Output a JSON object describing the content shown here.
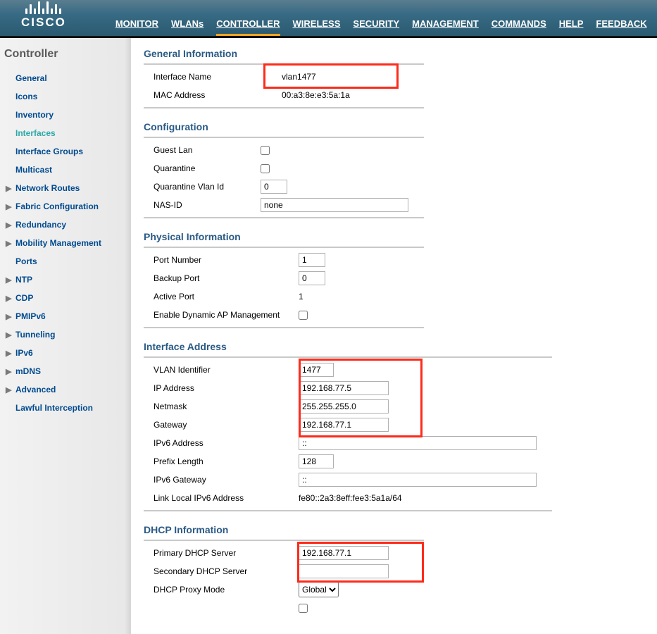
{
  "brand": "CISCO",
  "topnav": {
    "monitor": "MONITOR",
    "wlans": "WLANs",
    "controller": "CONTROLLER",
    "wireless": "WIRELESS",
    "security": "SECURITY",
    "management": "MANAGEMENT",
    "commands": "COMMANDS",
    "help": "HELP",
    "feedback": "FEEDBACK"
  },
  "sidebar": {
    "title": "Controller",
    "items": [
      {
        "label": "General",
        "arrow": false
      },
      {
        "label": "Icons",
        "arrow": false
      },
      {
        "label": "Inventory",
        "arrow": false
      },
      {
        "label": "Interfaces",
        "arrow": false,
        "current": true
      },
      {
        "label": "Interface Groups",
        "arrow": false
      },
      {
        "label": "Multicast",
        "arrow": false
      },
      {
        "label": "Network Routes",
        "arrow": true
      },
      {
        "label": "Fabric Configuration",
        "arrow": true
      },
      {
        "label": "Redundancy",
        "arrow": true
      },
      {
        "label": "Mobility Management",
        "arrow": true
      },
      {
        "label": "Ports",
        "arrow": false
      },
      {
        "label": "NTP",
        "arrow": true
      },
      {
        "label": "CDP",
        "arrow": true
      },
      {
        "label": "PMIPv6",
        "arrow": true
      },
      {
        "label": "Tunneling",
        "arrow": true
      },
      {
        "label": "IPv6",
        "arrow": true
      },
      {
        "label": "mDNS",
        "arrow": true
      },
      {
        "label": "Advanced",
        "arrow": true
      },
      {
        "label": "Lawful Interception",
        "arrow": false
      }
    ]
  },
  "sections": {
    "general": {
      "title": "General Information",
      "interface_name_label": "Interface Name",
      "interface_name": "vlan1477",
      "mac_label": "MAC Address",
      "mac": "00:a3:8e:e3:5a:1a"
    },
    "config": {
      "title": "Configuration",
      "guest_lan_label": "Guest Lan",
      "quarantine_label": "Quarantine",
      "qvlan_label": "Quarantine Vlan Id",
      "qvlan": "0",
      "nasid_label": "NAS-ID",
      "nasid": "none"
    },
    "phys": {
      "title": "Physical Information",
      "port_label": "Port Number",
      "port": "1",
      "backup_label": "Backup Port",
      "backup": "0",
      "active_label": "Active Port",
      "active": "1",
      "dyn_label": "Enable Dynamic AP Management"
    },
    "addr": {
      "title": "Interface Address",
      "vlan_label": "VLAN Identifier",
      "vlan": "1477",
      "ip_label": "IP Address",
      "ip": "192.168.77.5",
      "mask_label": "Netmask",
      "mask": "255.255.255.0",
      "gw_label": "Gateway",
      "gw": "192.168.77.1",
      "ipv6_label": "IPv6 Address",
      "ipv6": "::",
      "prefix_label": "Prefix Length",
      "prefix": "128",
      "ipv6gw_label": "IPv6 Gateway",
      "ipv6gw": "::",
      "lladdr_label": "Link Local IPv6 Address",
      "lladdr": "fe80::2a3:8eff:fee3:5a1a/64"
    },
    "dhcp": {
      "title": "DHCP Information",
      "primary_label": "Primary DHCP Server",
      "primary": "192.168.77.1",
      "secondary_label": "Secondary DHCP Server",
      "secondary": "",
      "proxy_label": "DHCP Proxy Mode",
      "proxy": "Global"
    }
  }
}
